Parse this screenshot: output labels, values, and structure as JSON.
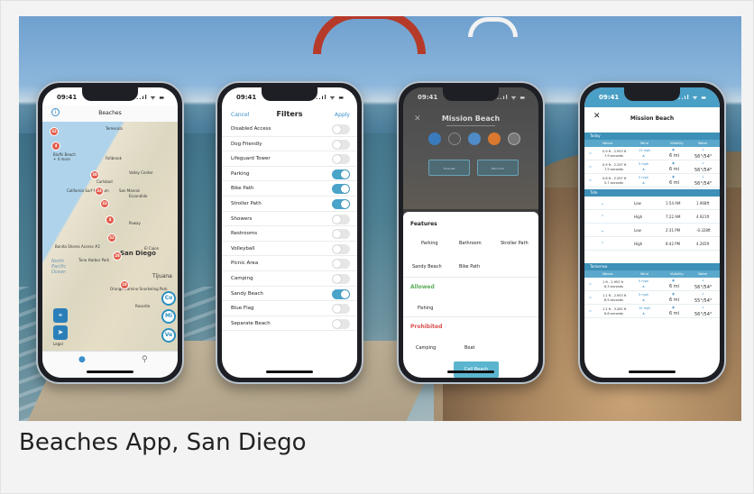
{
  "caption": "Beaches App, San Diego",
  "status_time": "09:41",
  "status_signal": "..ıl ᯤ ▬",
  "phone1": {
    "title": "Beaches",
    "info_glyph": "i",
    "map_labels": [
      {
        "text": "Temecula"
      },
      {
        "text": "Bluffs Beach\n+ 4 more"
      },
      {
        "text": "Fallbrook"
      },
      {
        "text": "Carlsbad"
      },
      {
        "text": "Valley Center"
      },
      {
        "text": "California Surf Museum"
      },
      {
        "text": "San Marcos"
      },
      {
        "text": "Escondido"
      },
      {
        "text": "Poway"
      },
      {
        "text": "Bonita Shores Access #2"
      },
      {
        "text": "El Cajon"
      },
      {
        "text": "Tuna Harbor Park"
      },
      {
        "text": "San Diego"
      },
      {
        "text": "Tijuana"
      },
      {
        "text": "Rosarito"
      },
      {
        "text": "Orange Camino Snorkeling Park"
      }
    ],
    "ocean_label": "North\nPacific\nOcean",
    "pins": [
      "32",
      "4",
      "38",
      "33",
      "33",
      "4",
      "52",
      "28",
      "19"
    ],
    "bubbles": [
      "Co",
      "Mi",
      "Ve"
    ],
    "legal": "Legal"
  },
  "phone2": {
    "cancel": "Cancel",
    "title": "Filters",
    "apply": "Apply",
    "filters": [
      {
        "label": "Disabled Access",
        "on": false
      },
      {
        "label": "Dog Friendly",
        "on": false
      },
      {
        "label": "Lifeguard Tower",
        "on": false
      },
      {
        "label": "Parking",
        "on": true
      },
      {
        "label": "Bike Path",
        "on": true
      },
      {
        "label": "Stroller Path",
        "on": true
      },
      {
        "label": "Showers",
        "on": false
      },
      {
        "label": "Restrooms",
        "on": false
      },
      {
        "label": "Volleyball",
        "on": false
      },
      {
        "label": "Picnic Area",
        "on": false
      },
      {
        "label": "Camping",
        "on": false
      },
      {
        "label": "Sandy Beach",
        "on": true
      },
      {
        "label": "Blue Flag",
        "on": false
      },
      {
        "label": "Separate Beach",
        "on": false
      }
    ]
  },
  "phone3": {
    "beach_name": "Mission Beach",
    "forecast_btn": "Forecast",
    "more_btn": "More Info",
    "features_heading": "Features",
    "features": [
      "Parking",
      "Bathroom",
      "Stroller Path",
      "Sandy Beach",
      "Bike Path"
    ],
    "allowed_heading": "Allowed",
    "allowed": [
      "Fishing"
    ],
    "prohibited_heading": "Prohibited",
    "prohibited": [
      "Camping",
      "Boat"
    ],
    "call_button": "Call Beach"
  },
  "phone4": {
    "title": "Mission Beach",
    "today": "Today",
    "tide": "Tide",
    "tomorrow": "Tomorrow",
    "columns": [
      "Waves",
      "Wind",
      "Visibility",
      "Water"
    ],
    "today_rows": [
      {
        "waves": "0.9 ft - 2.953 ft",
        "period": "7.9 seconds",
        "wind": "13 mph",
        "vis": "6 mi",
        "water": "56°/54°"
      },
      {
        "waves": "0.9 ft - 2.297 ft",
        "period": "7.5 seconds",
        "wind": "5 mph",
        "vis": "6 mi",
        "water": "56°/54°"
      },
      {
        "waves": "0.8 ft - 2.297 ft",
        "period": "5.7 seconds",
        "wind": "5 mph",
        "vis": "6 mi",
        "water": "56°/54°"
      }
    ],
    "tide_rows": [
      {
        "arrow": "⌄",
        "type": "Low",
        "time": "1:54 AM",
        "height": "1.968ft"
      },
      {
        "arrow": "⌃",
        "type": "High",
        "time": "7:22 AM",
        "height": "4.921ft"
      },
      {
        "arrow": "⌄",
        "type": "Low",
        "time": "2:31 PM",
        "height": "-0.328ft"
      },
      {
        "arrow": "⌃",
        "type": "High",
        "time": "8:42 PM",
        "height": "4.265ft"
      }
    ],
    "tomorrow_rows": [
      {
        "waves": "1 ft - 2.953 ft",
        "period": "6.3 seconds",
        "wind": "5 mph",
        "vis": "6 mi",
        "water": "56°/54°"
      },
      {
        "waves": "1.1 ft - 2.953 ft",
        "period": "6.5 seconds",
        "wind": "5 mph",
        "vis": "6 mi",
        "water": "55°/54°"
      },
      {
        "waves": "1.2 ft - 3.281 ft",
        "period": "6.8 seconds",
        "wind": "10 mph",
        "vis": "6 mi",
        "water": "56°/54°"
      }
    ]
  }
}
